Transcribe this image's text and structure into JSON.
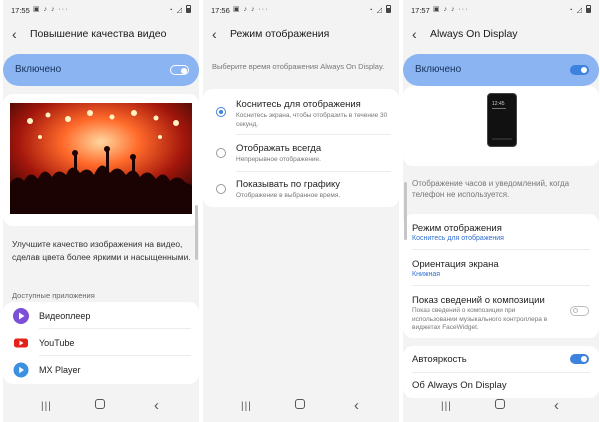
{
  "status": {
    "s1_time": "17:55",
    "s2_time": "17:56",
    "s3_time": "17:57",
    "left_icons": "▣ ♪ ♪ ···",
    "right_icons": "◔ ◿"
  },
  "screen1": {
    "title": "Повышение качества видео",
    "master_label": "Включено",
    "description": "Улучшите качество изображения на видео, сделав цвета более яркими и насыщенными.",
    "section_label": "Доступные приложения",
    "apps": [
      {
        "name": "Видеоплеер",
        "icon": "video-player-icon",
        "color": "#7b4fd6"
      },
      {
        "name": "YouTube",
        "icon": "youtube-icon",
        "color": "#e62117"
      },
      {
        "name": "MX Player",
        "icon": "mx-player-icon",
        "color": "#3d8fe0"
      }
    ]
  },
  "screen2": {
    "title": "Режим отображения",
    "hint": "Выберите время отображения Always On Display.",
    "options": [
      {
        "title": "Коснитесь для отображения",
        "subtitle": "Коснитесь экрана, чтобы отобразить в течение 30 секунд.",
        "selected": true
      },
      {
        "title": "Отображать всегда",
        "subtitle": "Непрерывное отображение.",
        "selected": false
      },
      {
        "title": "Показывать по графику",
        "subtitle": "Отображение в выбранное время.",
        "selected": false
      }
    ]
  },
  "screen3": {
    "title": "Always On Display",
    "master_label": "Включено",
    "preview_time": "12:45",
    "description": "Отображение часов и уведомлений, когда телефон не используется.",
    "mode_title": "Режим отображения",
    "mode_value": "Коснитесь для отображения",
    "orientation_title": "Ориентация экрана",
    "orientation_value": "Книжная",
    "music_title": "Показ сведений о композиции",
    "music_subtitle": "Показ сведений о композиции при использовании музыкального контроллера в виджетах FaceWidget.",
    "autobright_label": "Автояркость",
    "about_label": "Об Always On Display"
  },
  "colors": {
    "accent": "#3e82e0",
    "master_bg": "#8ab4f2"
  },
  "nav_icons": [
    "recent-apps-icon",
    "home-icon",
    "back-icon"
  ]
}
